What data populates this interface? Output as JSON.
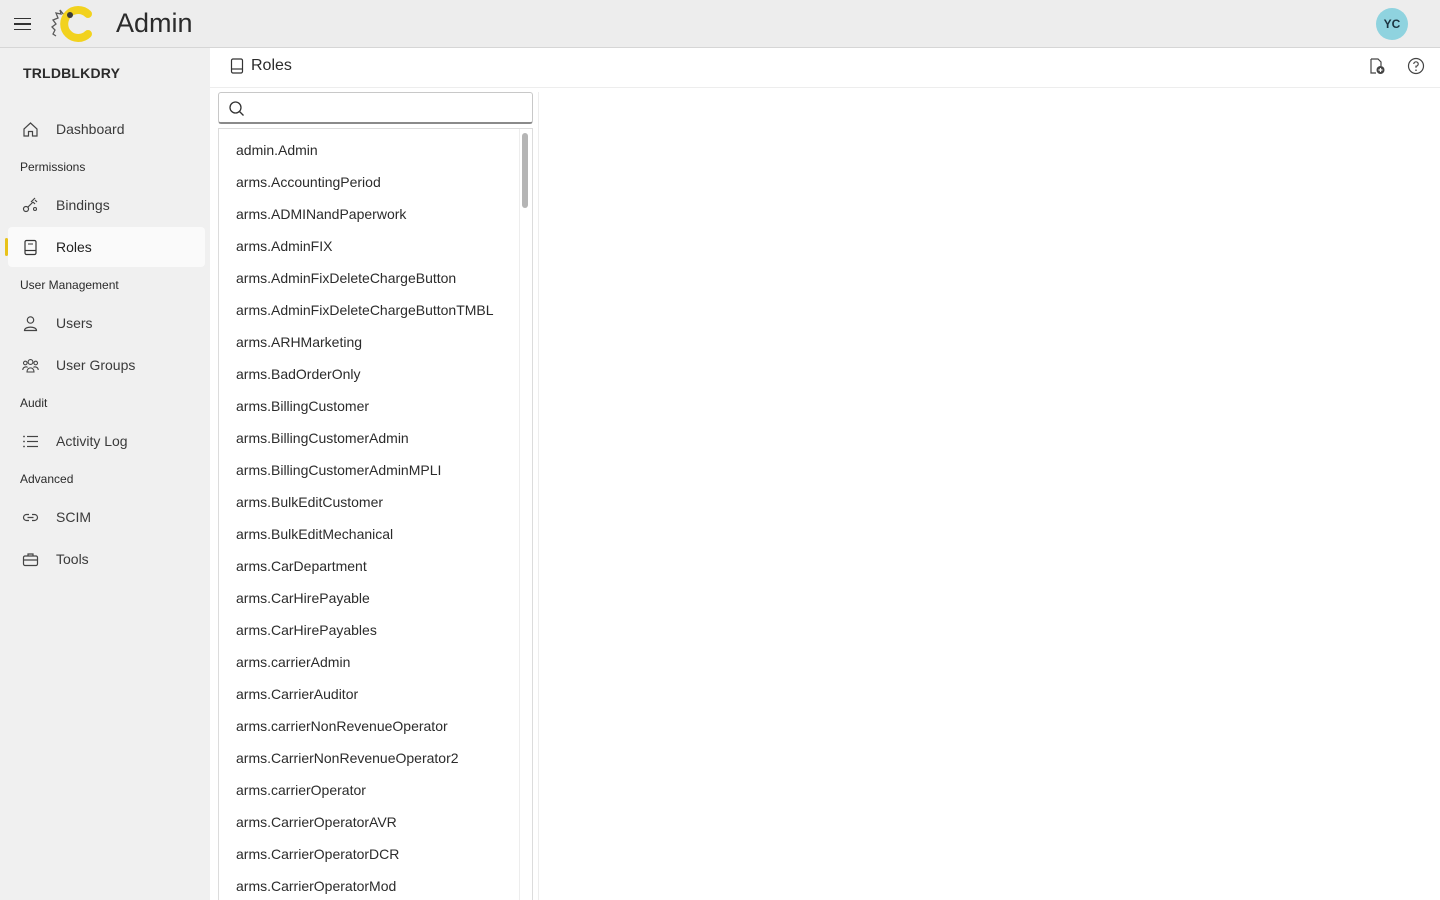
{
  "app": {
    "title": "Admin",
    "user_initials": "YC"
  },
  "colors": {
    "accent": "#e8c21a",
    "avatar_bg": "#8fd3df",
    "sidebar_bg": "#f0f0f0",
    "topbar_bg": "#ededed"
  },
  "sidebar": {
    "org_name": "TRLDBLKDRY",
    "dashboard": "Dashboard",
    "sections": {
      "permissions": "Permissions",
      "user_management": "User Management",
      "audit": "Audit",
      "advanced": "Advanced"
    },
    "items": {
      "bindings": "Bindings",
      "roles": "Roles",
      "users": "Users",
      "user_groups": "User Groups",
      "activity_log": "Activity Log",
      "scim": "SCIM",
      "tools": "Tools"
    },
    "active_item": "Roles"
  },
  "main": {
    "page_title": "Roles",
    "search": {
      "value": "",
      "placeholder": ""
    },
    "roles": [
      "admin.Admin",
      "arms.AccountingPeriod",
      "arms.ADMINandPaperwork",
      "arms.AdminFIX",
      "arms.AdminFixDeleteChargeButton",
      "arms.AdminFixDeleteChargeButtonTMBL",
      "arms.ARHMarketing",
      "arms.BadOrderOnly",
      "arms.BillingCustomer",
      "arms.BillingCustomerAdmin",
      "arms.BillingCustomerAdminMPLI",
      "arms.BulkEditCustomer",
      "arms.BulkEditMechanical",
      "arms.CarDepartment",
      "arms.CarHirePayable",
      "arms.CarHirePayables",
      "arms.carrierAdmin",
      "arms.CarrierAuditor",
      "arms.carrierNonRevenueOperator",
      "arms.CarrierNonRevenueOperator2",
      "arms.carrierOperator",
      "arms.CarrierOperatorAVR",
      "arms.CarrierOperatorDCR",
      "arms.CarrierOperatorMod"
    ]
  }
}
